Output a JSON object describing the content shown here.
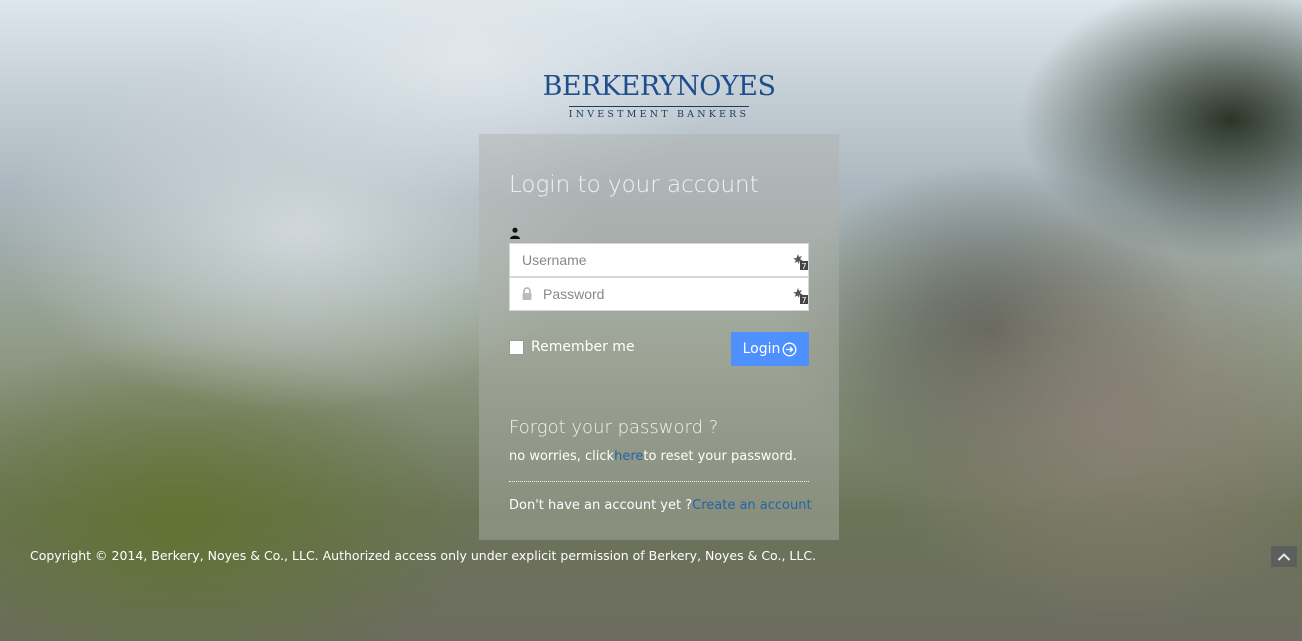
{
  "logo": {
    "main": "BERKERYNOYES",
    "sub": "INVESTMENT BANKERS"
  },
  "login": {
    "title": "Login to your account",
    "username_placeholder": "Username",
    "password_placeholder": "Password",
    "remember_label": "Remember me",
    "login_button": "Login"
  },
  "forgot": {
    "title": "Forgot your password ?",
    "text_before": "no worries, click",
    "link": "here",
    "text_after": "to reset your password."
  },
  "signup": {
    "text": "Don't have an account yet ?",
    "link": "Create an account"
  },
  "footer": {
    "copyright": "Copyright © 2014, Berkery, Noyes & Co., LLC. Authorized access only under explicit permission of Berkery, Noyes & Co., LLC."
  },
  "icons": {
    "user": "user-icon",
    "lock": "lock-icon",
    "key": "password-manager-key-icon",
    "login_arrow": "arrow-circle-right-icon",
    "scroll_top": "chevron-up-icon"
  },
  "colors": {
    "button": "#4d90fe",
    "link": "#1f65a8",
    "logo": "#1f4e8c"
  }
}
